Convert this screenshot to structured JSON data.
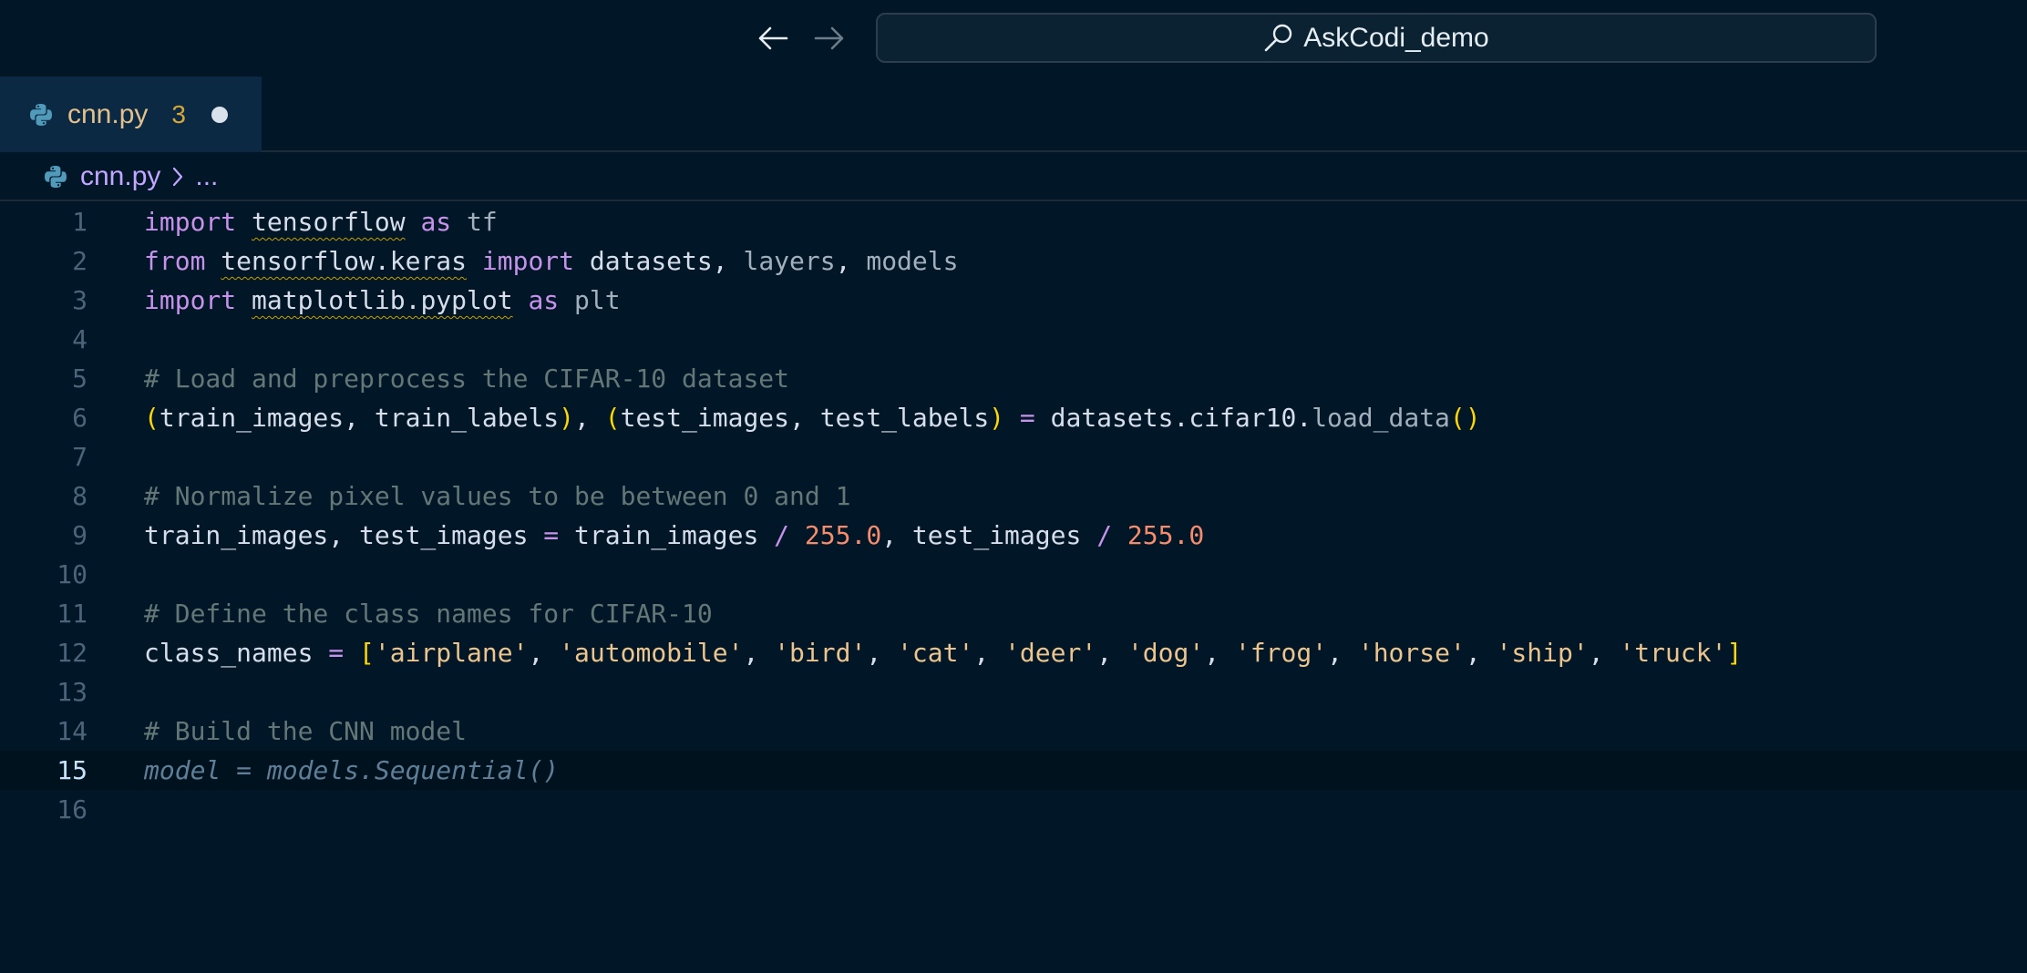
{
  "window": {
    "search_text": "AskCodi_demo"
  },
  "tab": {
    "filename": "cnn.py",
    "problem_count": "3"
  },
  "breadcrumb": {
    "file": "cnn.py",
    "more": "..."
  },
  "editor": {
    "current_line": 15,
    "lines": [
      {
        "n": "1"
      },
      {
        "n": "2"
      },
      {
        "n": "3"
      },
      {
        "n": "4"
      },
      {
        "n": "5"
      },
      {
        "n": "6"
      },
      {
        "n": "7"
      },
      {
        "n": "8"
      },
      {
        "n": "9"
      },
      {
        "n": "10"
      },
      {
        "n": "11"
      },
      {
        "n": "12"
      },
      {
        "n": "13"
      },
      {
        "n": "14"
      },
      {
        "n": "15"
      },
      {
        "n": "16"
      }
    ],
    "tokens": {
      "l1": [
        "import",
        " ",
        "tensorflow",
        " ",
        "as",
        " tf"
      ],
      "l2": [
        "from",
        " ",
        "tensorflow.keras",
        " ",
        "import",
        " datasets, ",
        "layers",
        ", ",
        "models"
      ],
      "l3": [
        "import",
        " ",
        "matplotlib.pyplot",
        " ",
        "as",
        " plt"
      ],
      "l5": "# Load and preprocess the CIFAR-10 dataset",
      "l6": [
        "(",
        "train_images, train_labels",
        ")",
        ", ",
        "(",
        "test_images, test_labels",
        ")",
        " ",
        "=",
        " datasets.cifar10.",
        "load_data",
        "(",
        ")"
      ],
      "l8": "# Normalize pixel values to be between 0 and 1",
      "l9": [
        "train_images, test_images ",
        "=",
        " train_images ",
        "/",
        " ",
        "255.0",
        ", test_images ",
        "/",
        " ",
        "255.0"
      ],
      "l11": "# Define the class names for CIFAR-10",
      "l12": [
        "class_names ",
        "=",
        " ",
        "[",
        "'airplane'",
        ", ",
        "'automobile'",
        ", ",
        "'bird'",
        ", ",
        "'cat'",
        ", ",
        "'deer'",
        ", ",
        "'dog'",
        ", ",
        "'frog'",
        ", ",
        "'horse'",
        ", ",
        "'ship'",
        ", ",
        "'truck'",
        "]"
      ],
      "l14": "# Build the CNN model",
      "l15": "model = models.Sequential()"
    }
  },
  "colors": {
    "background": "#011627",
    "keyword": "#c792ea",
    "string": "#ecc48d",
    "number": "#f78c6c",
    "comment": "#637777",
    "bracket": "#ffd700"
  },
  "icons": {
    "back": "arrow-left-icon",
    "forward": "arrow-right-icon",
    "search": "search-icon",
    "python": "python-icon"
  }
}
